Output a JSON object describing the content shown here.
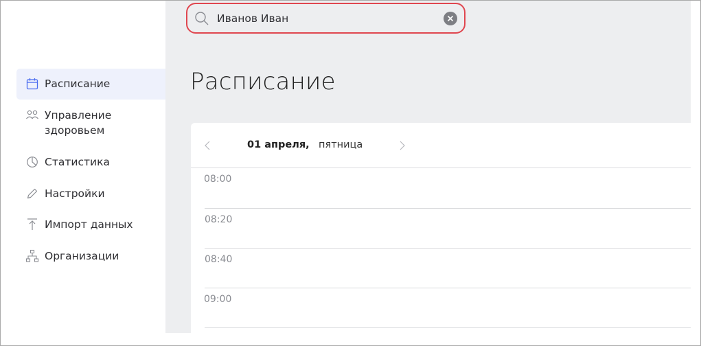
{
  "search": {
    "value": "Иванов Иван"
  },
  "sidebar": {
    "items": [
      {
        "label": "Расписание",
        "icon": "calendar-icon",
        "active": true
      },
      {
        "label": "Управление\nздоровьем",
        "icon": "users-icon",
        "active": false
      },
      {
        "label": "Статистика",
        "icon": "pie-chart-icon",
        "active": false
      },
      {
        "label": "Настройки",
        "icon": "pencil-icon",
        "active": false
      },
      {
        "label": "Импорт данных",
        "icon": "upload-icon",
        "active": false
      },
      {
        "label": "Организации",
        "icon": "org-chart-icon",
        "active": false
      }
    ]
  },
  "main": {
    "title": "Расписание",
    "date": {
      "main": "01 апреля,",
      "day": "пятница"
    },
    "slots": [
      "08:00",
      "08:20",
      "08:40",
      "09:00"
    ]
  },
  "colors": {
    "accent": "#4a6cf0",
    "search_border": "#e0464f",
    "active_bg": "#eef1fc"
  }
}
